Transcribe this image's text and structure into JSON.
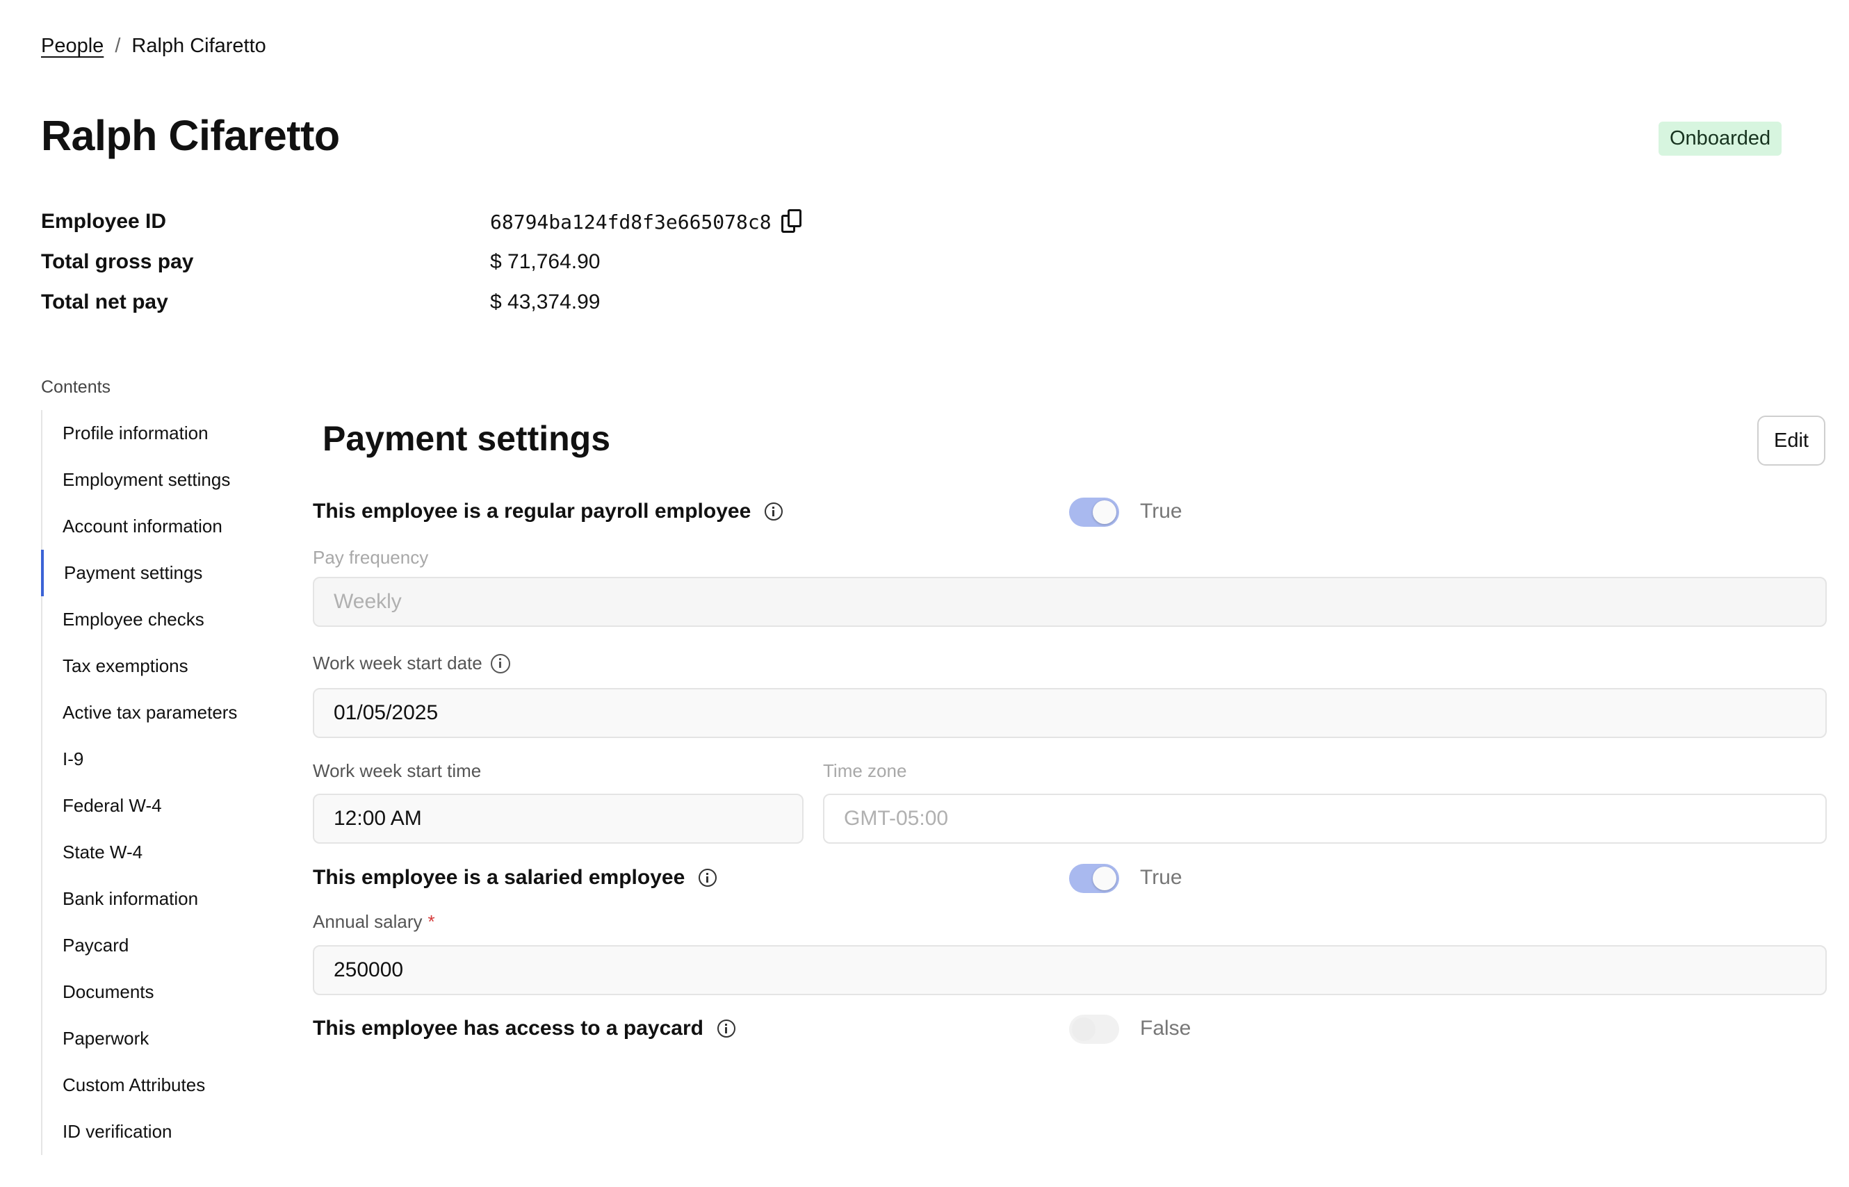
{
  "breadcrumb": {
    "parent": "People",
    "separator": "/",
    "current": "Ralph Cifaretto"
  },
  "header": {
    "title": "Ralph Cifaretto",
    "status": "Onboarded",
    "status_color": "#d7f5df"
  },
  "summary": [
    {
      "label": "Employee ID",
      "value": "68794ba124fd8f3e665078c8",
      "copyable": true
    },
    {
      "label": "Total gross pay",
      "value": "$ 71,764.90"
    },
    {
      "label": "Total net pay",
      "value": "$ 43,374.99"
    }
  ],
  "contents": {
    "label": "Contents",
    "items": [
      "Profile information",
      "Employment settings",
      "Account information",
      "Payment settings",
      "Employee checks",
      "Tax exemptions",
      "Active tax parameters",
      "I-9",
      "Federal W-4",
      "State W-4",
      "Bank information",
      "Paycard",
      "Documents",
      "Paperwork",
      "Custom Attributes",
      "ID verification"
    ],
    "active": "Payment settings",
    "active_color": "#3b63d6"
  },
  "section": {
    "title": "Payment settings",
    "edit_label": "Edit",
    "regular_payroll": {
      "label": "This employee is a regular payroll employee",
      "state": "True"
    },
    "pay_frequency": {
      "label": "Pay frequency",
      "value": "Weekly"
    },
    "work_week_start_date": {
      "label": "Work week start date",
      "value": "01/05/2025"
    },
    "work_week_start_time": {
      "label": "Work week start time",
      "value": "12:00  AM"
    },
    "time_zone": {
      "label": "Time zone",
      "value": "GMT-05:00"
    },
    "salaried": {
      "label": "This employee is a salaried employee",
      "state": "True"
    },
    "annual_salary": {
      "label": "Annual salary",
      "required_mark": "*",
      "value": "250000"
    },
    "paycard_access": {
      "label": "This employee has access to a paycard",
      "state": "False"
    }
  },
  "colors": {
    "toggle_on": "#a9b9ef",
    "toggle_off": "#f1f1f1",
    "required": "#d53a3a"
  },
  "icons": {
    "copy": "copy-icon",
    "info": "info-icon"
  }
}
